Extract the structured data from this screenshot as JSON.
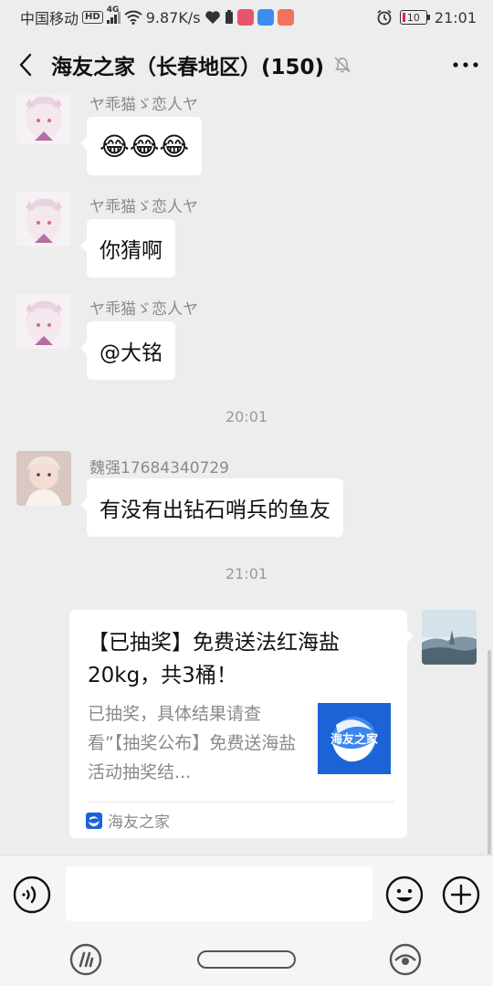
{
  "status_bar": {
    "carrier": "中国移动",
    "hd": "HD",
    "net_type": "4G",
    "speed": "9.87K/s",
    "battery": "10",
    "time": "21:01"
  },
  "header": {
    "title": "海友之家（长春地区）(150)"
  },
  "messages": [
    {
      "sender": "ヤ乖猫ゞ恋人ヤ",
      "text": "😂😂😂"
    },
    {
      "sender": "ヤ乖猫ゞ恋人ヤ",
      "text": "你猜啊"
    },
    {
      "sender": "ヤ乖猫ゞ恋人ヤ",
      "text": "@大铭"
    },
    {
      "sender": "魏强17684340729",
      "text": "有没有出钻石哨兵的鱼友"
    }
  ],
  "timestamps": [
    "20:01",
    "21:01"
  ],
  "card": {
    "title": "【已抽奖】免费送法红海盐20kg，共3桶！",
    "description": "已抽奖，具体结果请查看”【抽奖公布】免费送海盐活动抽奖结...",
    "thumb_text": "海友之家",
    "source": "海友之家"
  },
  "input": {
    "placeholder": ""
  },
  "colors": {
    "background": "#ededed",
    "bubble": "#ffffff",
    "brand_blue": "#1c63d6"
  }
}
